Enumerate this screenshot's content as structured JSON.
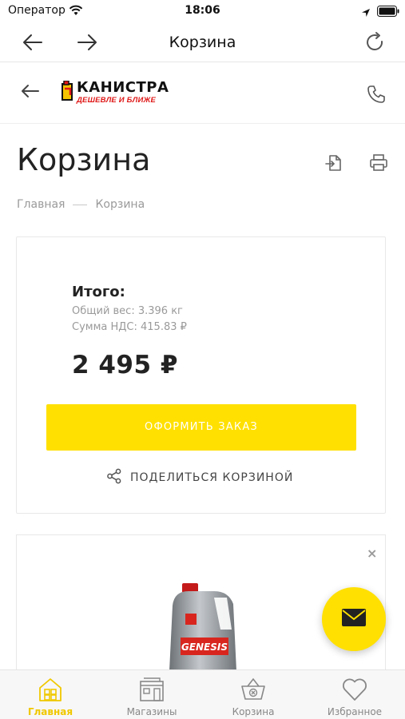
{
  "status_bar": {
    "carrier": "Оператор",
    "time": "18:06"
  },
  "browser": {
    "title": "Корзина"
  },
  "header": {
    "logo_name": "КАНИСТРА",
    "logo_slogan": "ДЕШЕВЛЕ И БЛИЖЕ"
  },
  "page": {
    "title": "Корзина"
  },
  "breadcrumb": {
    "home": "Главная",
    "current": "Корзина"
  },
  "summary": {
    "total_label": "Итого:",
    "weight": "Общий вес: 3.396 кг",
    "vat": "Сумма НДС: 415.83 ₽",
    "total_amount": "2 495 ₽",
    "checkout_label": "ОФОРМИТЬ ЗАКАЗ",
    "share_label": "ПОДЕЛИТЬСЯ КОРЗИНОЙ"
  },
  "product": {
    "remove_symbol": "×",
    "image_label": "GENESIS"
  },
  "tabs": [
    {
      "label": "Главная",
      "icon": "home-icon",
      "active": true
    },
    {
      "label": "Магазины",
      "icon": "store-icon",
      "active": false
    },
    {
      "label": "Корзина",
      "icon": "basket-icon",
      "active": false
    },
    {
      "label": "Избранное",
      "icon": "heart-icon",
      "active": false
    }
  ],
  "colors": {
    "accent": "#ffe000",
    "active_tab": "#f0c800",
    "logo_red": "#e01818",
    "muted_text": "#9a9a9a"
  }
}
